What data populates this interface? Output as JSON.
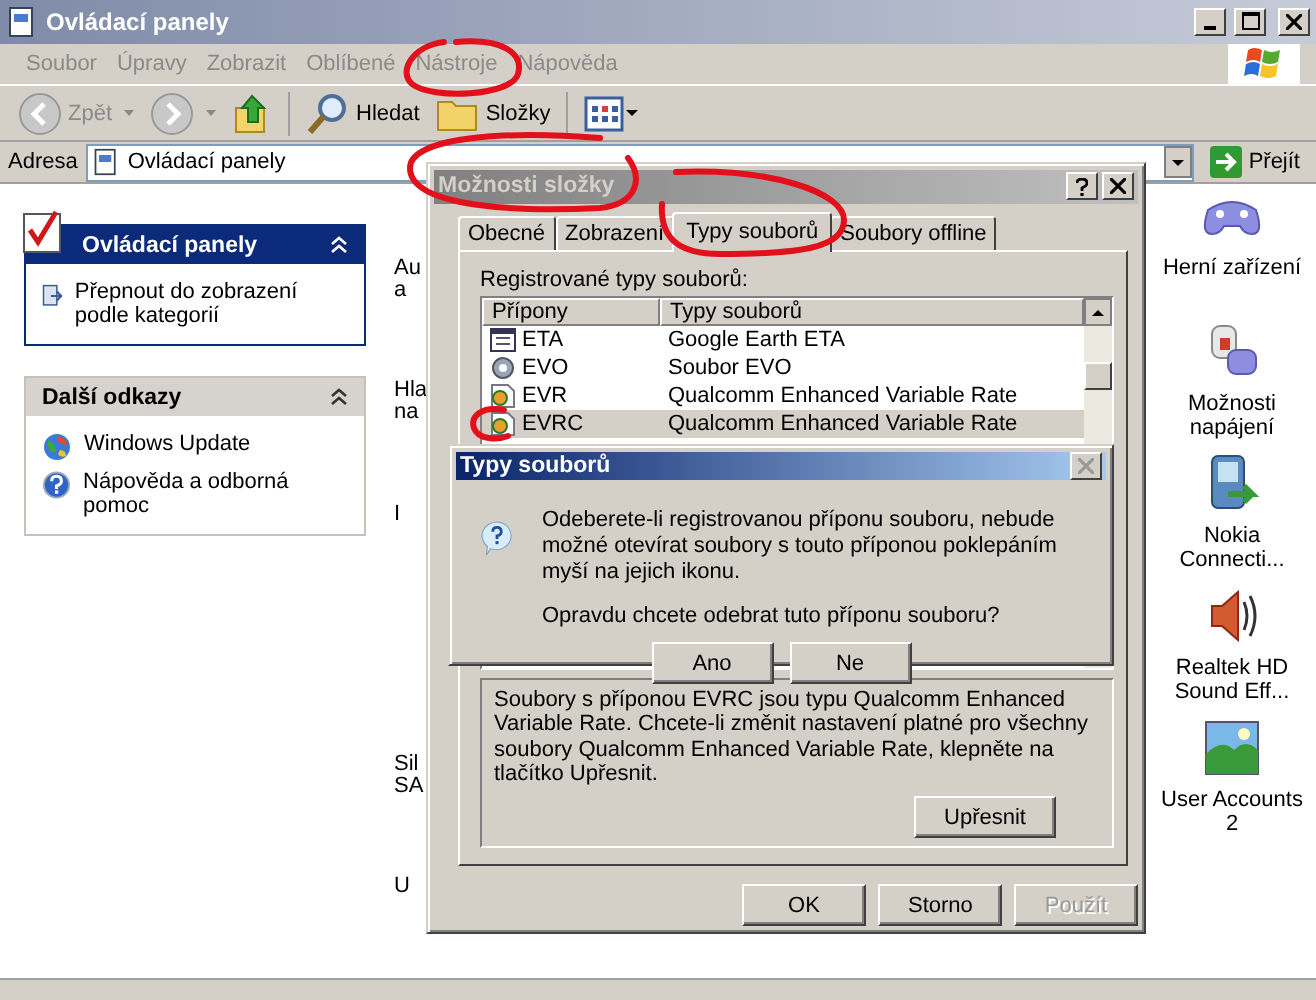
{
  "window": {
    "title": "Ovládací panely"
  },
  "menu": [
    {
      "label": "Soubor",
      "disabled": true
    },
    {
      "label": "Úpravy",
      "disabled": true
    },
    {
      "label": "Zobrazit",
      "disabled": true
    },
    {
      "label": "Oblíbené",
      "disabled": true
    },
    {
      "label": "Nástroje",
      "disabled": true
    },
    {
      "label": "Nápověda",
      "disabled": true
    }
  ],
  "toolbar": [
    {
      "kind": "back",
      "label": "Zpět",
      "disabled": true
    },
    {
      "kind": "forward",
      "disabled": true
    },
    {
      "kind": "up"
    },
    {
      "kind": "search",
      "label": "Hledat"
    },
    {
      "kind": "folders",
      "label": "Složky"
    },
    {
      "kind": "views"
    }
  ],
  "address": {
    "label": "Adresa",
    "value": "Ovládací panely",
    "go_button": "Přejít"
  },
  "sidebar": [
    {
      "kind": "primary",
      "title": "Ovládací panely",
      "items": [
        {
          "kind": "switch",
          "label": "Přepnout do zobrazení podle kategorií"
        }
      ]
    },
    {
      "kind": "secondary",
      "title": "Další odkazy",
      "items": [
        {
          "kind": "update",
          "label": "Windows Update"
        },
        {
          "kind": "help",
          "label": "Nápověda a odborná pomoc"
        }
      ]
    }
  ],
  "hidden_icon_labels": [
    {
      "lines": [
        "Au",
        "a"
      ]
    },
    {
      "lines": [
        "Hla",
        "na"
      ]
    },
    {
      "lines": [
        "I"
      ]
    },
    {
      "lines": [
        "Sil",
        "SA"
      ]
    },
    {
      "lines": [
        "U"
      ]
    }
  ],
  "icons": [
    {
      "kind": "gamepad",
      "label": "Herní zařízení"
    },
    {
      "kind": "power",
      "label": "Možnosti napájení"
    },
    {
      "kind": "phone",
      "label": "Nokia Connecti..."
    },
    {
      "kind": "speaker",
      "label": "Realtek HD Sound Eff..."
    },
    {
      "kind": "landscape",
      "label": "User Accounts 2"
    }
  ],
  "folder_options": {
    "title": "Možnosti složky",
    "tabs": [
      {
        "label": "Obecné",
        "selected": false
      },
      {
        "label": "Zobrazení",
        "selected": false
      },
      {
        "label": "Typy souborů",
        "selected": true
      },
      {
        "label": "Soubory offline",
        "selected": false
      }
    ],
    "list_label": "Registrované typy souborů:",
    "columns": [
      "Přípony",
      "Typy souborů"
    ],
    "rows": [
      {
        "kind": "grid",
        "ext": "ETA",
        "type": "Google Earth ETA",
        "selected": false
      },
      {
        "kind": "gear",
        "ext": "EVO",
        "type": "Soubor EVO",
        "selected": false
      },
      {
        "kind": "media",
        "ext": "EVR",
        "type": "Qualcomm Enhanced Variable Rate",
        "selected": false
      },
      {
        "kind": "media",
        "ext": "EVRC",
        "type": "Qualcomm Enhanced Variable Rate",
        "selected": true
      }
    ],
    "details": "Soubory s příponou EVRC jsou typu Qualcomm Enhanced Variable Rate. Chcete-li změnit nastavení platné pro všechny soubory Qualcomm Enhanced Variable Rate, klepněte na tlačítko Upřesnit.",
    "advanced_button": "Upřesnit",
    "buttons": [
      {
        "label": "OK",
        "disabled": false
      },
      {
        "label": "Storno",
        "disabled": false
      },
      {
        "label": "Použít",
        "disabled": true
      }
    ]
  },
  "message_box": {
    "title": "Typy souborů",
    "text": "Odeberete-li registrovanou příponu souboru, nebude možné otevírat soubory s touto příponou poklepáním myší na jejich ikonu.",
    "question": "Opravdu chcete odebrat tuto příponu souboru?",
    "buttons": [
      "Ano",
      "Ne"
    ]
  }
}
